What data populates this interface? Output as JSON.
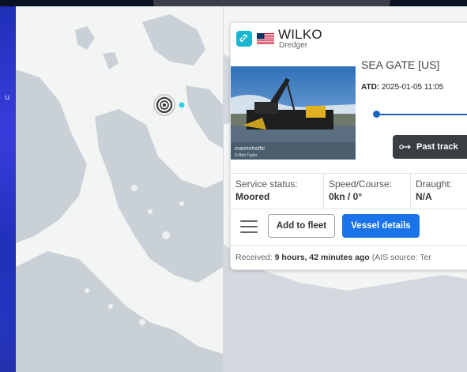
{
  "background": {
    "left_label": "u",
    "colors": {
      "desktop_blue": "#1c2a8f",
      "top_bar": "#0b1322"
    }
  },
  "map": {
    "colors": {
      "water": "#f3f4f4",
      "land": "#c9d1d7"
    },
    "vessel_marker_icon": "target-ring-icon",
    "other_vessel_icon": "cyan-dot-icon"
  },
  "vessel_card": {
    "link_icon": "link-icon",
    "flag_icon": "us-flag-icon",
    "name": "WILKO",
    "type": "Dredger",
    "photo": {
      "watermark": "marinetraffic",
      "credit": "© Bob Taylor"
    },
    "destination": "SEA GATE [US]",
    "atd_label": "ATD:",
    "atd_value": "2025-01-05 11:05",
    "past_track_icon": "track-icon",
    "past_track_label": "Past track",
    "stats": {
      "status_label": "Service status:",
      "status_value": "Moored",
      "speed_label": "Speed/Course:",
      "speed_value": "0kn / 0°",
      "draught_label": "Draught:",
      "draught_value": "N/A"
    },
    "menu_icon": "hamburger-icon",
    "add_fleet_label": "Add to fleet",
    "vessel_details_label": "Vessel details",
    "received": {
      "prefix": "Received:",
      "time": "9 hours, 42 minutes ago",
      "source": "(AIS source: Ter"
    },
    "colors": {
      "accent": "#1a73e8",
      "link_badge": "#19b6d2",
      "dark_button": "#3a3d42"
    }
  }
}
